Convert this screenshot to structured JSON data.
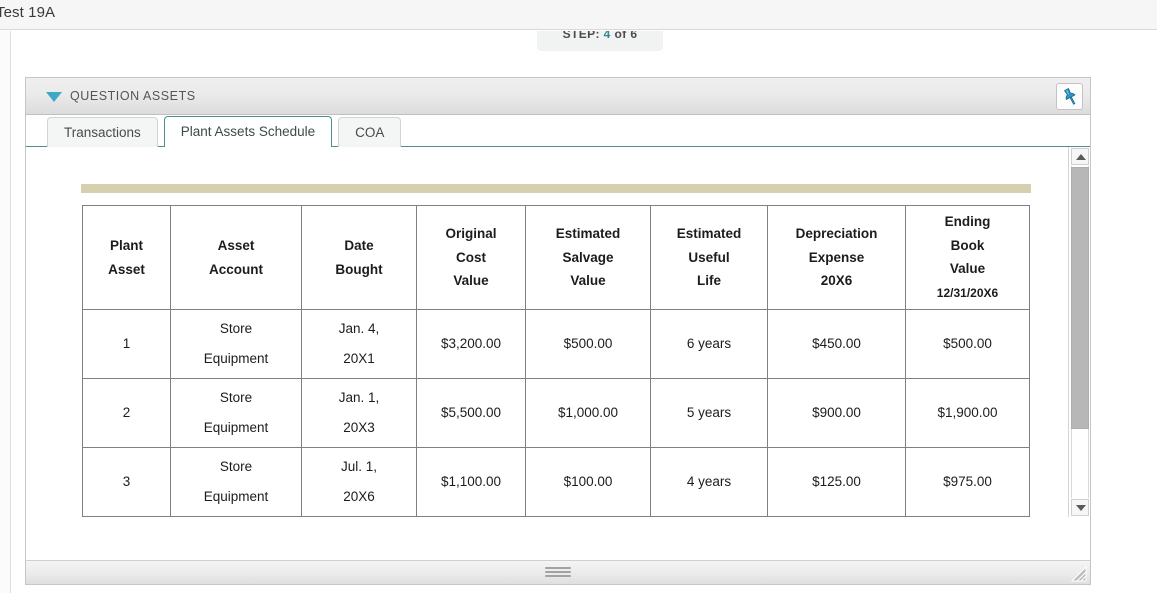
{
  "window": {
    "title": "Test 19A"
  },
  "step_indicator": {
    "prefix": "STEP: ",
    "current": "4",
    "suffix": " of 6"
  },
  "panel": {
    "title": "QUESTION ASSETS",
    "collapse_icon": "caret-down-icon",
    "pin_icon": "pushpin-icon",
    "accent_color": "#3fa9c4",
    "rule_color": "#d6d0af"
  },
  "tabs": [
    {
      "label": "Transactions",
      "active": false
    },
    {
      "label": "Plant Assets Schedule",
      "active": true
    },
    {
      "label": "COA",
      "active": false
    }
  ],
  "schedule": {
    "columns": [
      {
        "lines": [
          "Plant",
          "Asset"
        ]
      },
      {
        "lines": [
          "Asset",
          "Account"
        ]
      },
      {
        "lines": [
          "Date",
          "Bought"
        ]
      },
      {
        "lines": [
          "Original",
          "Cost",
          "Value"
        ]
      },
      {
        "lines": [
          "Estimated",
          "Salvage",
          "Value"
        ]
      },
      {
        "lines": [
          "Estimated",
          "Useful",
          "Life"
        ]
      },
      {
        "lines": [
          "Depreciation",
          "Expense",
          "20X6"
        ]
      },
      {
        "lines": [
          "Ending",
          "Book",
          "Value",
          "12/31/20X6"
        ]
      }
    ],
    "rows": [
      {
        "plant_asset": "1",
        "asset_account": [
          "Store",
          "Equipment"
        ],
        "date_bought": [
          "Jan. 4,",
          "20X1"
        ],
        "original_cost_value": "$3,200.00",
        "estimated_salvage_value": "$500.00",
        "estimated_useful_life": "6 years",
        "depreciation_expense_20x6": "$450.00",
        "ending_book_value": "$500.00"
      },
      {
        "plant_asset": "2",
        "asset_account": [
          "Store",
          "Equipment"
        ],
        "date_bought": [
          "Jan. 1,",
          "20X3"
        ],
        "original_cost_value": "$5,500.00",
        "estimated_salvage_value": "$1,000.00",
        "estimated_useful_life": "5 years",
        "depreciation_expense_20x6": "$900.00",
        "ending_book_value": "$1,900.00"
      },
      {
        "plant_asset": "3",
        "asset_account": [
          "Store",
          "Equipment"
        ],
        "date_bought": [
          "Jul. 1,",
          "20X6"
        ],
        "original_cost_value": "$1,100.00",
        "estimated_salvage_value": "$100.00",
        "estimated_useful_life": "4 years",
        "depreciation_expense_20x6": "$125.00",
        "ending_book_value": "$975.00"
      }
    ]
  },
  "scrollbar": {
    "up_icon": "triangle-up-icon",
    "down_icon": "triangle-down-icon"
  },
  "footer": {
    "drag_handle_icon": "drag-handle-icon",
    "resize_grip_icon": "resize-grip-icon"
  }
}
